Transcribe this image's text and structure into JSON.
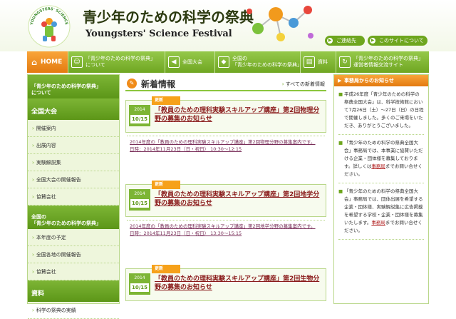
{
  "header": {
    "logo_text": "YOUNGSTERS' SCIENCE FESTIVAL",
    "title": "青少年のための科学の祭典",
    "subtitle": "Youngsters' Science Festival",
    "access_label": "ご連絡先",
    "about_label": "このサイトについて"
  },
  "nav": {
    "home": "HOME",
    "about": "「青少年のための科学の祭典」\nについて",
    "national": "全国大会",
    "national_fest": "全国の\n「青少年のための科学の祭典」",
    "resources": "資料",
    "office": "「青少年のための科学の祭典」\n運営者情報交流サイト"
  },
  "sidebar": {
    "about_head": "「青少年のための科学の祭典」\nについて",
    "national_head": "全国大会",
    "national_items": [
      "開催案内",
      "出展内容",
      "実験解説集",
      "全国大会の開催報告",
      "協賛会社"
    ],
    "fest_head": "全国の\n「青少年のための科学の祭典」",
    "fest_items": [
      "本年度の予定",
      "全国各地の開催報告",
      "協賛会社"
    ],
    "resources_head": "資料",
    "resources_items": [
      "科学の祭典の実績"
    ]
  },
  "news": {
    "title": "新着情報",
    "all_link": "すべての新着情報",
    "badge": "更新",
    "items": [
      {
        "year": "2014",
        "md": "10/15",
        "headline": "「教員のための理科実験スキルアップ講座」第2回物理分野の募集のお知らせ",
        "body": "2014年度の「教員のための理科実験スキルアップ講座」第2回物理分野の募集案内です。",
        "date_line": "日時：2014年11月23日（日・祝日） 10:30～12:15"
      },
      {
        "year": "2014",
        "md": "10/15",
        "headline": "「教員のための理科実験スキルアップ講座」第2回地学分野の募集のお知らせ",
        "body": "2014年度の「教員のための理科実験スキルアップ講座」第2回地学分野の募集案内です。",
        "date_line": "日時：2014年11月23日（日・祝日） 13:30～15:15"
      },
      {
        "year": "2014",
        "md": "10/15",
        "headline": "「教員のための理科実験スキルアップ講座」第2回生物分野の募集のお知らせ",
        "body": "",
        "date_line": ""
      }
    ]
  },
  "rightbar": {
    "head": "事務局からのお知らせ",
    "notices": [
      {
        "text": "平成26年度「青少年のための科学の祭典全国大会」は、科学技術館において7月26日（土）～27日（日）の日程で開催しました。多くのご来場をいただき、ありがとうございました。",
        "link": "",
        "tail": ""
      },
      {
        "text": "「青少年のための科学の祭典全国大会」事務局では、本事業に協賛いただける企業・団体様を募集しております。詳しくは",
        "link": "事務局",
        "tail": "までお問い合せください。"
      },
      {
        "text": "「青少年のための科学の祭典全国大会」事務局では、団体出展を希望する企業・団体様、実験解説集に広告掲載を希望する学校・企業・団体様を募集いたします。",
        "link": "事務局",
        "tail": "までお問い合せください。"
      }
    ]
  },
  "colors": {
    "accent_green": "#6ea61e",
    "accent_orange": "#f08c1a",
    "headline_red": "#8a1b1b"
  }
}
